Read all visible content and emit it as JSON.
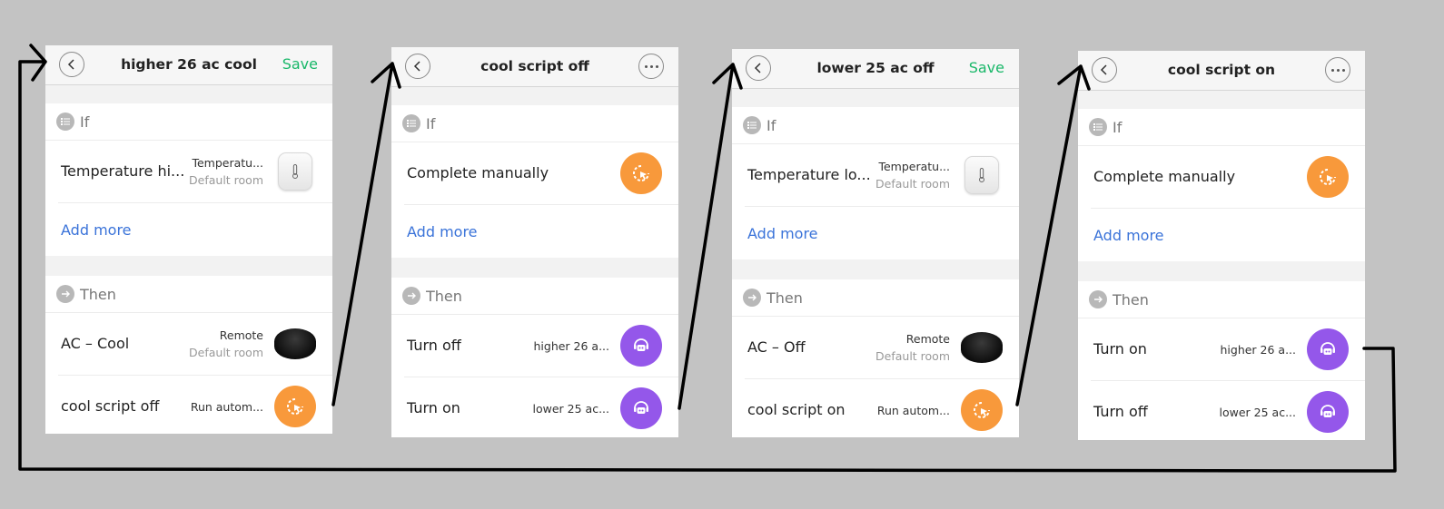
{
  "panels": [
    {
      "title": "higher 26 ac cool",
      "save_label": "Save",
      "if_label": "If",
      "if_rows": [
        {
          "label": "Temperature hi...",
          "meta1": "Temperatu...",
          "meta2": "Default room",
          "icon": "thermometer-icon"
        }
      ],
      "add_more": "Add more",
      "then_label": "Then",
      "then_rows": [
        {
          "label": "AC – Cool",
          "meta1": "Remote",
          "meta2": "Default room",
          "icon": "remote-icon"
        },
        {
          "label": "cool script off",
          "meta1": "Run autom...",
          "icon": "manual-click-icon"
        }
      ]
    },
    {
      "title": "cool script off",
      "if_label": "If",
      "if_rows": [
        {
          "label": "Complete manually",
          "icon": "manual-click-icon"
        }
      ],
      "add_more": "Add more",
      "then_label": "Then",
      "then_rows": [
        {
          "label": "Turn off",
          "meta1": "higher 26 a...",
          "icon": "robot-icon"
        },
        {
          "label": "Turn on",
          "meta1": "lower 25 ac...",
          "icon": "robot-icon"
        }
      ]
    },
    {
      "title": "lower 25 ac off",
      "save_label": "Save",
      "if_label": "If",
      "if_rows": [
        {
          "label": "Temperature lo...",
          "meta1": "Temperatu...",
          "meta2": "Default room",
          "icon": "thermometer-icon"
        }
      ],
      "add_more": "Add more",
      "then_label": "Then",
      "then_rows": [
        {
          "label": "AC – Off",
          "meta1": "Remote",
          "meta2": "Default room",
          "icon": "remote-icon"
        },
        {
          "label": "cool script on",
          "meta1": "Run autom...",
          "icon": "manual-click-icon"
        }
      ]
    },
    {
      "title": "cool script on",
      "if_label": "If",
      "if_rows": [
        {
          "label": "Complete manually",
          "icon": "manual-click-icon"
        }
      ],
      "add_more": "Add more",
      "then_label": "Then",
      "then_rows": [
        {
          "label": "Turn on",
          "meta1": "higher 26 a...",
          "icon": "robot-icon"
        },
        {
          "label": "Turn off",
          "meta1": "lower 25 ac...",
          "icon": "robot-icon"
        }
      ]
    }
  ],
  "colors": {
    "background": "#c3c3c3",
    "save": "#1bb86a",
    "link": "#3a73d9",
    "orange_icon": "#f8993b",
    "purple_icon": "#9457ea"
  }
}
